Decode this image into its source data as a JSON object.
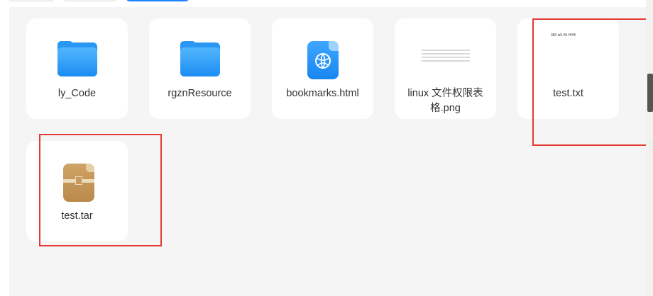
{
  "files": [
    {
      "name": "ly_Code",
      "type": "folder",
      "icon": "folder-icon"
    },
    {
      "name": "rgznResource",
      "type": "folder",
      "icon": "folder-icon"
    },
    {
      "name": "bookmarks.html",
      "type": "html",
      "icon": "web-document-icon"
    },
    {
      "name": "linux 文件权限表格.png",
      "type": "image",
      "icon": "image-thumbnail"
    },
    {
      "name": "test.txt",
      "type": "text",
      "icon": "text-thumbnail",
      "preview_text": "360 is5 t% HYB"
    },
    {
      "name": "test.tar",
      "type": "archive",
      "icon": "archive-icon"
    }
  ],
  "colors": {
    "folder_blue": "#2a97f5",
    "accent": "#1e88ff",
    "highlight_red": "#e53935",
    "archive_tan": "#c69a5d"
  }
}
